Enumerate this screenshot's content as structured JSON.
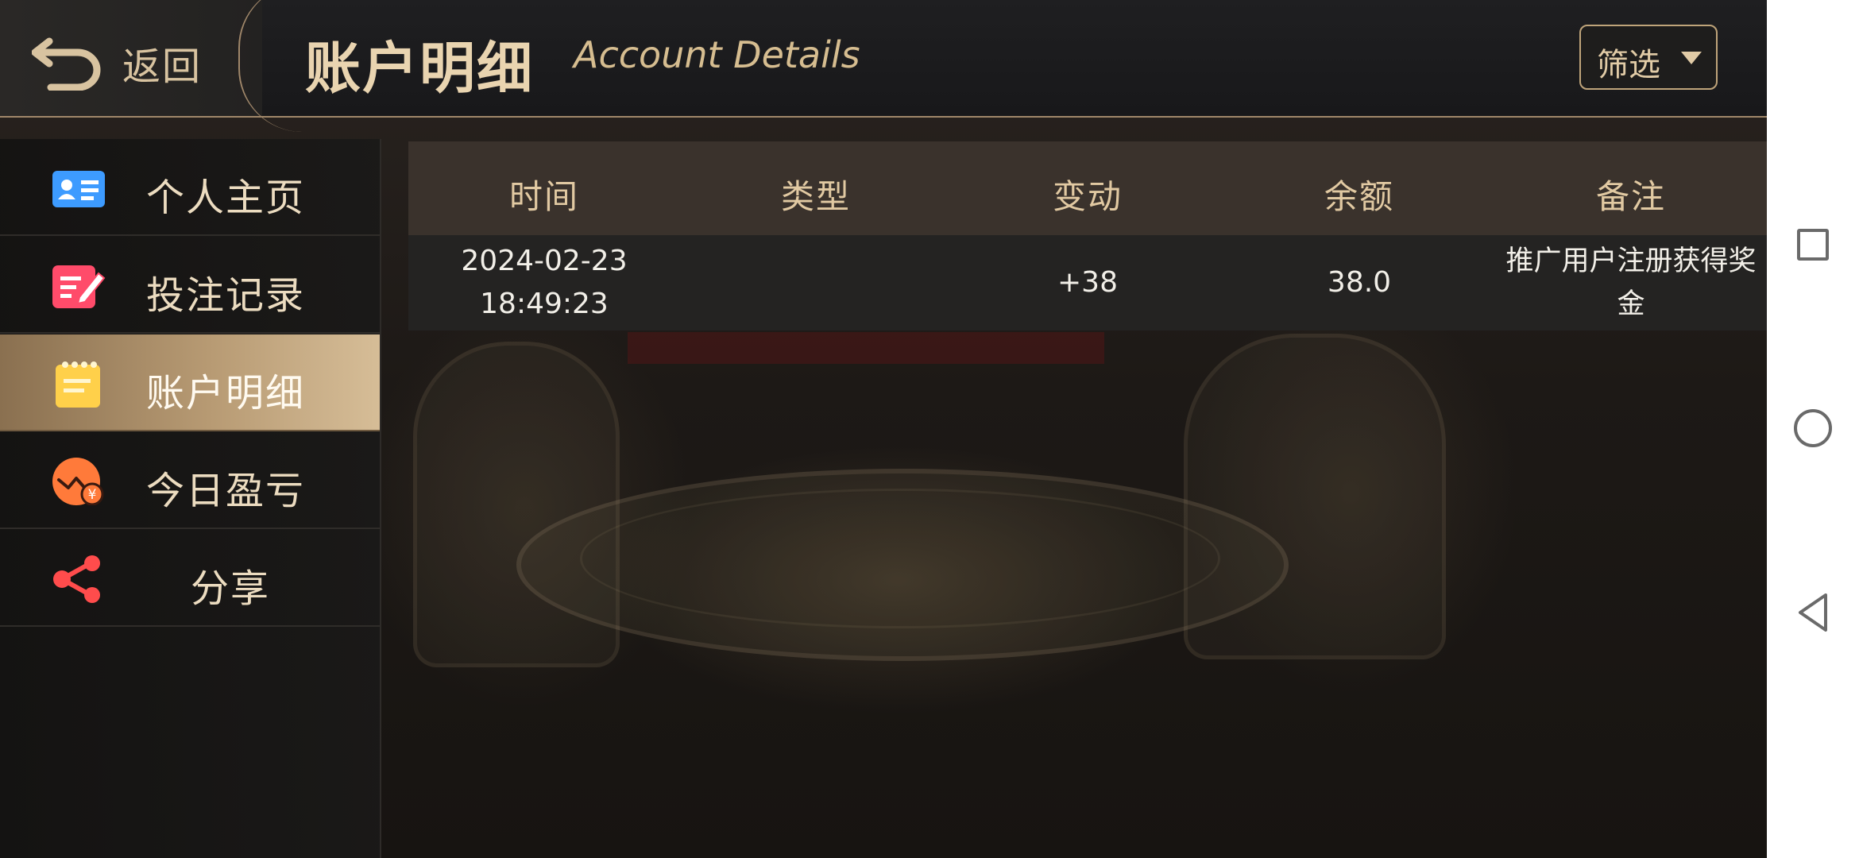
{
  "header": {
    "back_label": "返回",
    "title_zh": "账户明细",
    "title_en": "Account Details",
    "filter_label": "筛选"
  },
  "sidebar": {
    "items": [
      {
        "label": "个人主页",
        "icon": "id-card-icon",
        "icon_color": "#3d9bff"
      },
      {
        "label": "投注记录",
        "icon": "edit-note-icon",
        "icon_color": "#ff4b6a"
      },
      {
        "label": "账户明细",
        "icon": "notepad-icon",
        "icon_color": "#ffd04a",
        "active": true
      },
      {
        "label": "今日盈亏",
        "icon": "profit-loss-icon",
        "icon_color": "#ff7a3a"
      },
      {
        "label": "分享",
        "icon": "share-icon",
        "icon_color": "#ff4c4c"
      }
    ]
  },
  "table": {
    "columns": [
      "时间",
      "类型",
      "变动",
      "余额",
      "备注"
    ],
    "rows": [
      {
        "time_date": "2024-02-23",
        "time_clock": "18:49:23",
        "type": "",
        "change": "+38",
        "balance": "38.0",
        "note_line1": "推广用户注册获得奖",
        "note_line2": "金"
      }
    ]
  },
  "navbar": {
    "buttons": [
      "recent-apps-icon",
      "home-icon",
      "back-triangle-icon"
    ]
  },
  "colors": {
    "accent_gold": "#e9d4b0",
    "border_gold": "#a0876a",
    "active_item": "#b79a73"
  }
}
